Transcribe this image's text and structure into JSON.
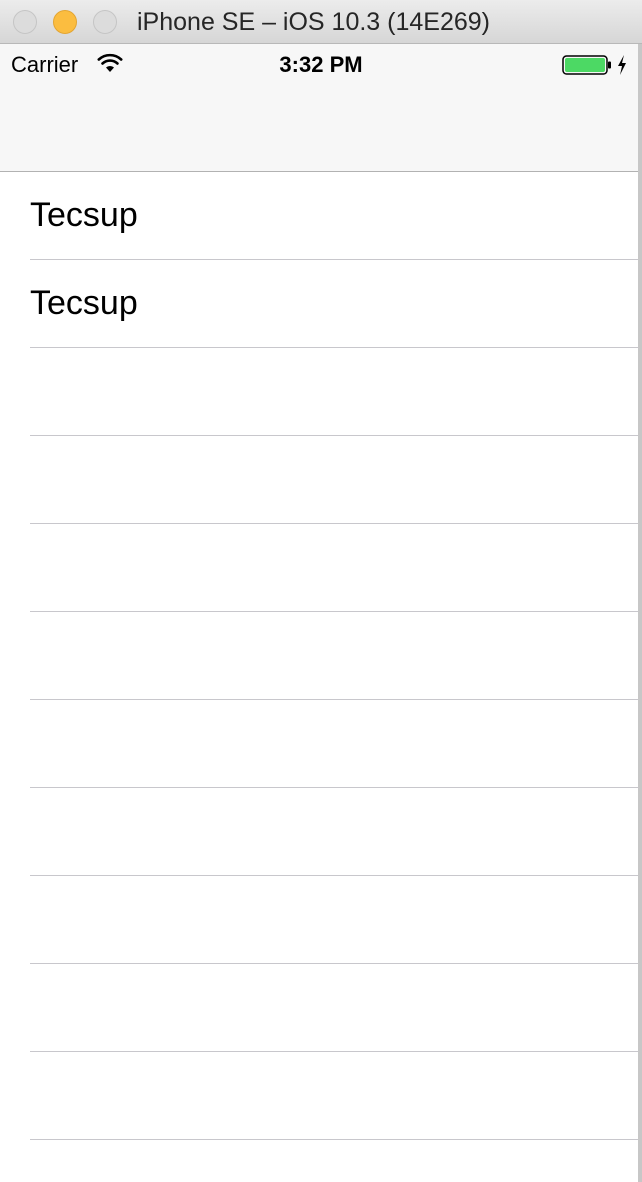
{
  "window": {
    "title": "iPhone SE – iOS 10.3 (14E269)"
  },
  "status_bar": {
    "carrier": "Carrier",
    "time": "3:32 PM",
    "wifi_icon": "wifi-icon",
    "battery_icon": "battery-full-charging-icon",
    "battery_color": "#4cd964"
  },
  "table": {
    "rows": [
      {
        "label": "Tecsup"
      },
      {
        "label": "Tecsup"
      },
      {
        "label": ""
      },
      {
        "label": ""
      },
      {
        "label": ""
      },
      {
        "label": ""
      },
      {
        "label": ""
      },
      {
        "label": ""
      },
      {
        "label": ""
      },
      {
        "label": ""
      },
      {
        "label": ""
      }
    ]
  }
}
